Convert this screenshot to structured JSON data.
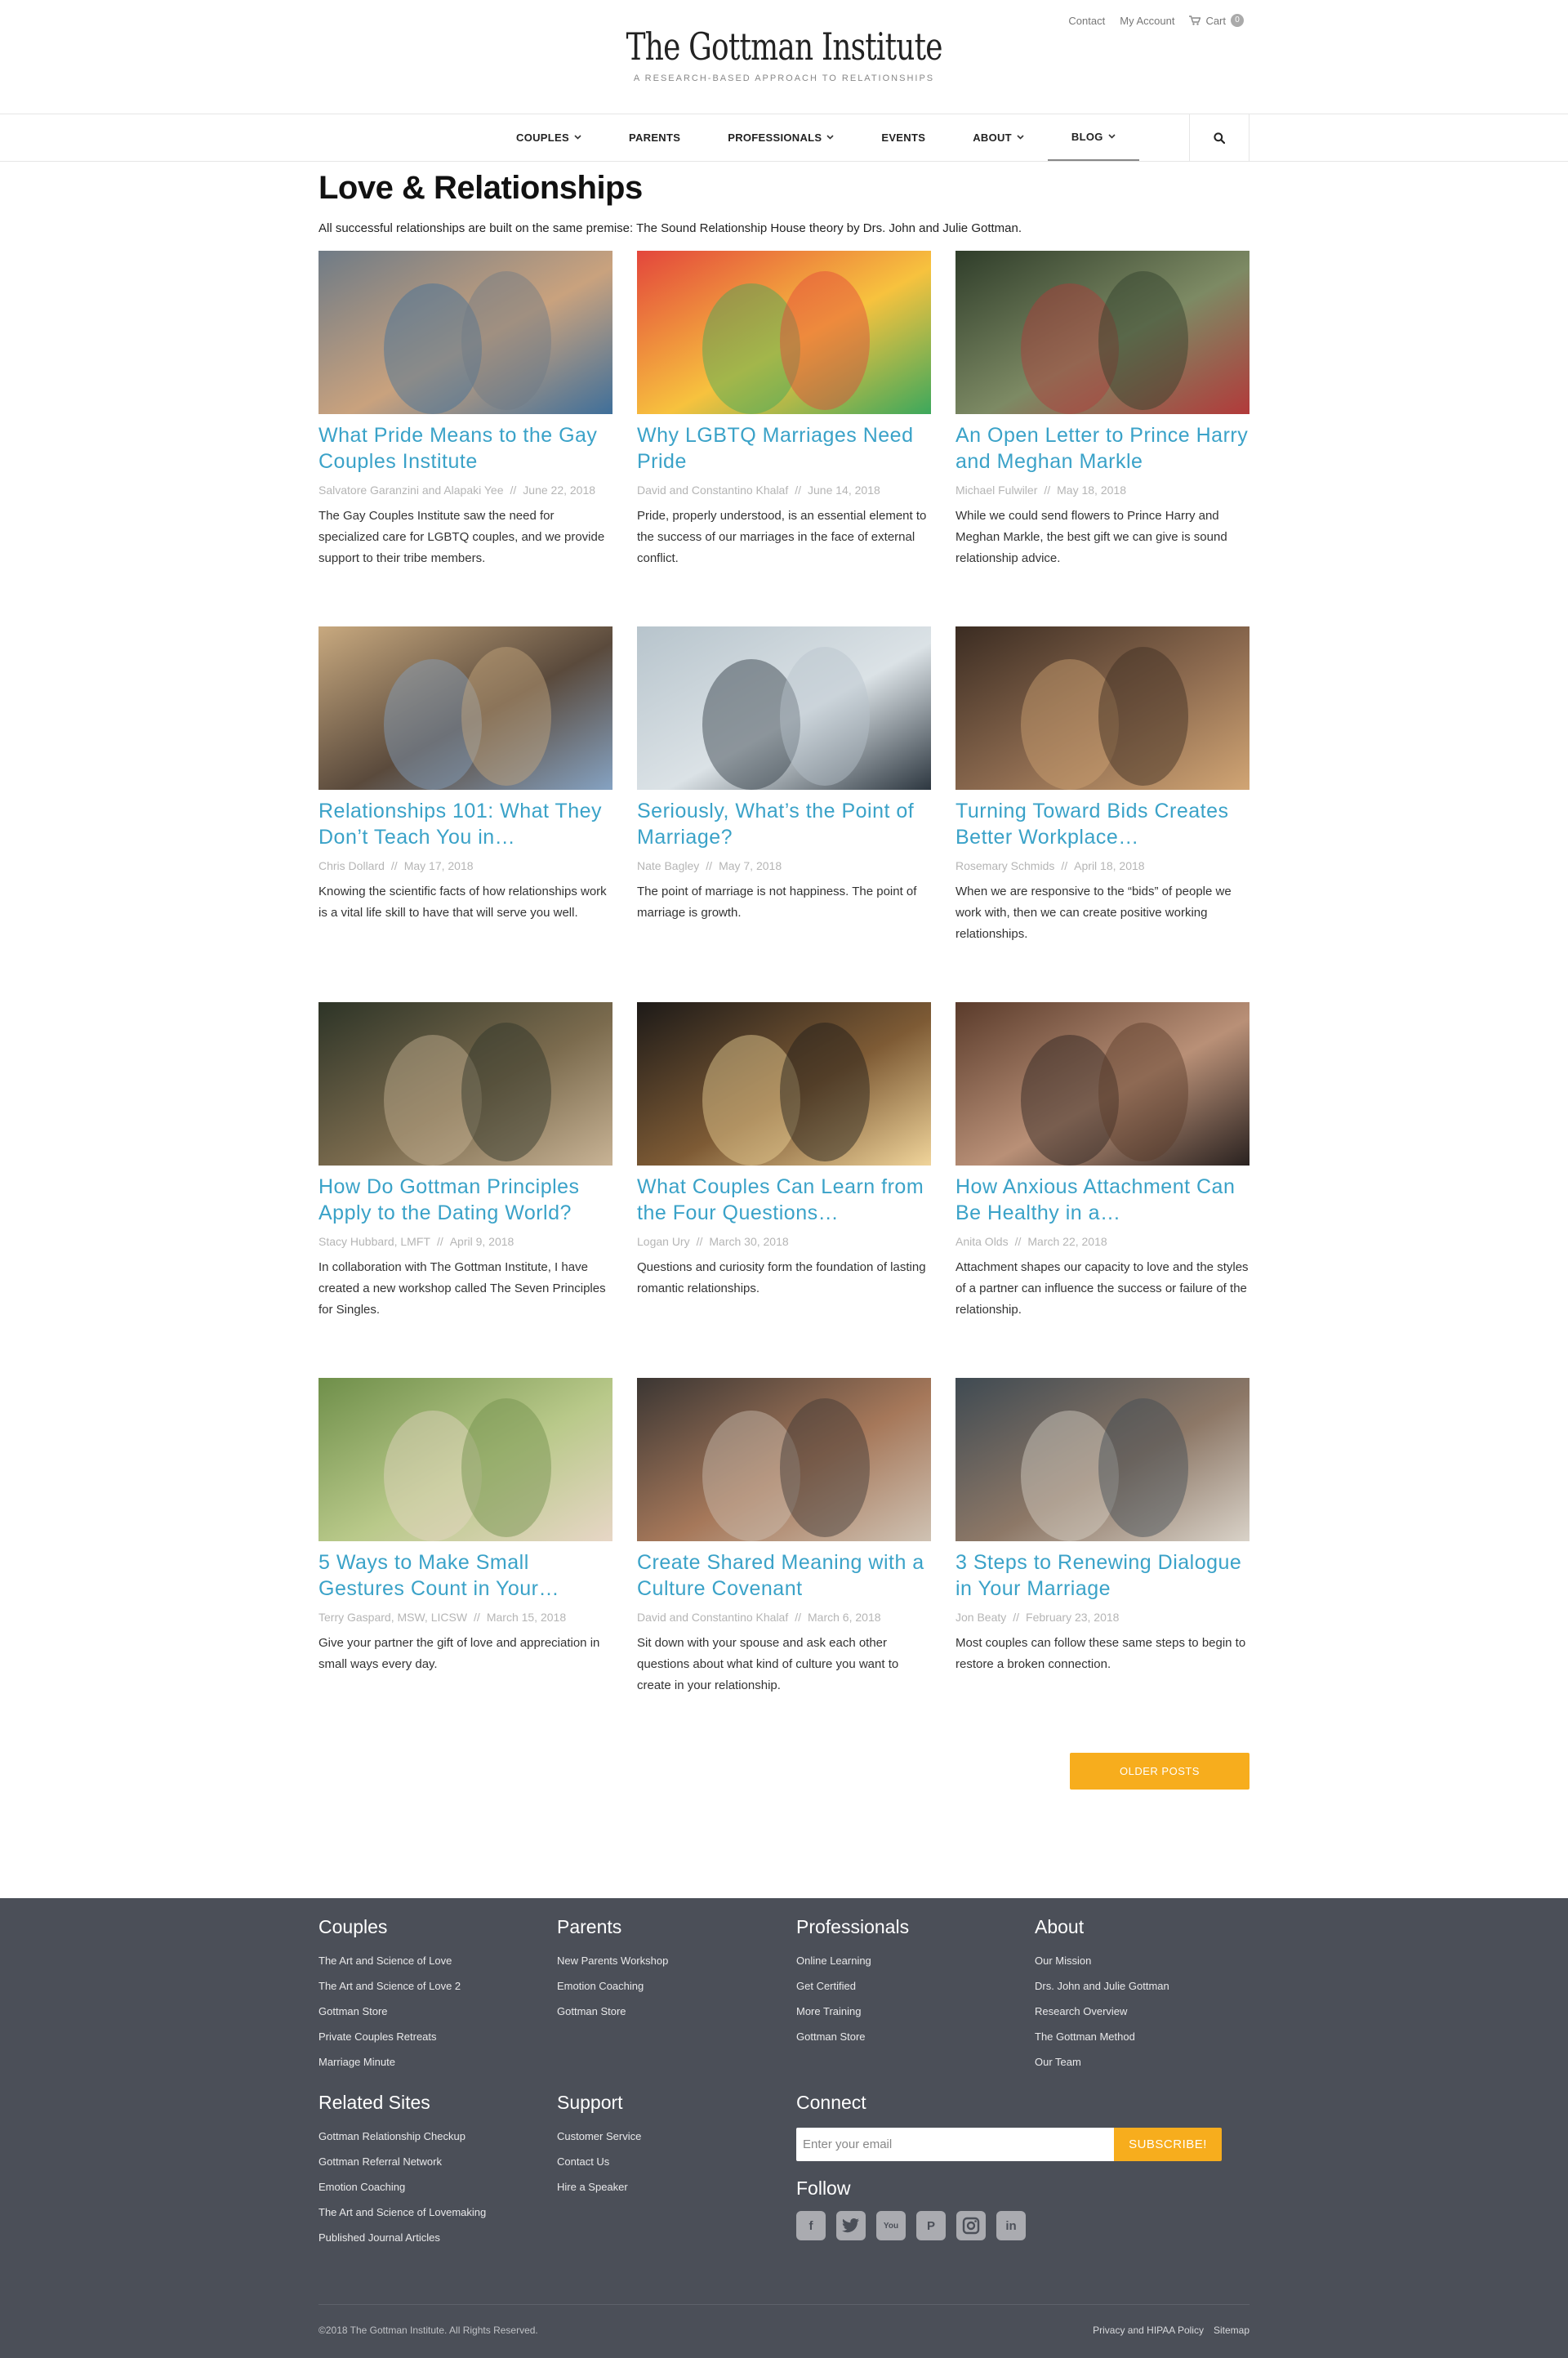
{
  "utility": {
    "contact": "Contact",
    "account": "My Account",
    "cart": "Cart",
    "cart_count": "0"
  },
  "brand": {
    "logo": "The Gottman Institute",
    "tagline": "A RESEARCH-BASED APPROACH TO RELATIONSHIPS"
  },
  "nav": {
    "items": [
      {
        "label": "COUPLES",
        "dropdown": true
      },
      {
        "label": "PARENTS",
        "dropdown": false
      },
      {
        "label": "PROFESSIONALS",
        "dropdown": true
      },
      {
        "label": "EVENTS",
        "dropdown": false
      },
      {
        "label": "ABOUT",
        "dropdown": true
      },
      {
        "label": "BLOG",
        "dropdown": true,
        "active": true
      }
    ],
    "search_icon": "search-icon"
  },
  "page": {
    "title": "Love & Relationships",
    "intro": "All successful relationships are built on the same premise: The Sound Relationship House theory by Drs. John and Julie Gottman."
  },
  "posts": [
    {
      "title": "What Pride Means to the Gay Couples Institute",
      "author": "Salvatore Garanzini and Alapaki Yee",
      "date": "June 22, 2018",
      "excerpt": "The Gay Couples Institute saw the need for specialized care for LGBTQ couples, and we provide support to their tribe members."
    },
    {
      "title": "Why LGBTQ Marriages Need Pride",
      "author": "David and Constantino Khalaf",
      "date": "June 14, 2018",
      "excerpt": "Pride, properly understood, is an essential element to the success of our marriages in the face of external conflict."
    },
    {
      "title": "An Open Letter to Prince Harry and Meghan Markle",
      "author": "Michael Fulwiler",
      "date": "May 18, 2018",
      "excerpt": "While we could send flowers to Prince Harry and Meghan Markle, the best gift we can give is sound relationship advice."
    },
    {
      "title": "Relationships 101: What They Don’t Teach You in…",
      "author": "Chris Dollard",
      "date": "May 17, 2018",
      "excerpt": "Knowing the scientific facts of how relationships work is a vital life skill to have that will serve you well."
    },
    {
      "title": "Seriously, What’s the Point of Marriage?",
      "author": "Nate Bagley",
      "date": "May 7, 2018",
      "excerpt": "The point of marriage is not happiness. The point of marriage is growth."
    },
    {
      "title": "Turning Toward Bids Creates Better Workplace…",
      "author": "Rosemary Schmids",
      "date": "April 18, 2018",
      "excerpt": "When we are responsive to the “bids” of people we work with, then we can create positive working relationships."
    },
    {
      "title": "How Do Gottman Principles Apply to the Dating World?",
      "author": "Stacy Hubbard, LMFT",
      "date": "April 9, 2018",
      "excerpt": "In collaboration with The Gottman Institute, I have created a new workshop called The Seven Principles for Singles."
    },
    {
      "title": "What Couples Can Learn from the Four Questions…",
      "author": "Logan Ury",
      "date": "March 30, 2018",
      "excerpt": "Questions and curiosity form the foundation of lasting romantic relationships."
    },
    {
      "title": "How Anxious Attachment Can Be Healthy in a…",
      "author": "Anita Olds",
      "date": "March 22, 2018",
      "excerpt": "Attachment shapes our capacity to love and the styles of a partner can influence the success or failure of the relationship."
    },
    {
      "title": "5 Ways to Make Small Gestures Count in Your…",
      "author": "Terry Gaspard, MSW, LICSW",
      "date": "March 15, 2018",
      "excerpt": "Give your partner the gift of love and appreciation in small ways every day."
    },
    {
      "title": "Create Shared Meaning with a Culture Covenant",
      "author": "David and Constantino Khalaf",
      "date": "March 6, 2018",
      "excerpt": "Sit down with your spouse and ask each other questions about what kind of culture you want to create in your relationship."
    },
    {
      "title": "3 Steps to Renewing Dialogue in Your Marriage",
      "author": "Jon Beaty",
      "date": "February 23, 2018",
      "excerpt": "Most couples can follow these same steps to begin to restore a broken connection."
    }
  ],
  "older_posts": "OLDER POSTS",
  "footer": {
    "couples": {
      "heading": "Couples",
      "links": [
        "The Art and Science of Love",
        "The Art and Science of Love 2",
        "Gottman Store",
        "Private Couples Retreats",
        "Marriage Minute"
      ]
    },
    "parents": {
      "heading": "Parents",
      "links": [
        "New Parents Workshop",
        "Emotion Coaching",
        "Gottman Store"
      ]
    },
    "professionals": {
      "heading": "Professionals",
      "links": [
        "Online Learning",
        "Get Certified",
        "More Training",
        "Gottman Store"
      ]
    },
    "about": {
      "heading": "About",
      "links": [
        "Our Mission",
        "Drs. John and Julie Gottman",
        "Research Overview",
        "The Gottman Method",
        "Our Team"
      ]
    },
    "related": {
      "heading": "Related Sites",
      "links": [
        "Gottman Relationship Checkup",
        "Gottman Referral Network",
        "Emotion Coaching",
        "The Art and Science of Lovemaking",
        "Published Journal Articles"
      ]
    },
    "support": {
      "heading": "Support",
      "links": [
        "Customer Service",
        "Contact Us",
        "Hire a Speaker"
      ]
    },
    "connect": {
      "heading": "Connect",
      "email_placeholder": "Enter your email",
      "subscribe": "SUBSCRIBE!"
    },
    "follow": {
      "heading": "Follow",
      "icons": [
        "facebook-icon",
        "twitter-icon",
        "youtube-icon",
        "pinterest-icon",
        "instagram-icon",
        "linkedin-icon"
      ]
    },
    "copyright": "©2018 The Gottman Institute. All Rights Reserved.",
    "privacy": "Privacy and HIPAA Policy",
    "sitemap": "Sitemap"
  },
  "colors": {
    "accent": "#3aa2c8",
    "button": "#f7ad1d",
    "footer_bg": "#4b4f58"
  }
}
